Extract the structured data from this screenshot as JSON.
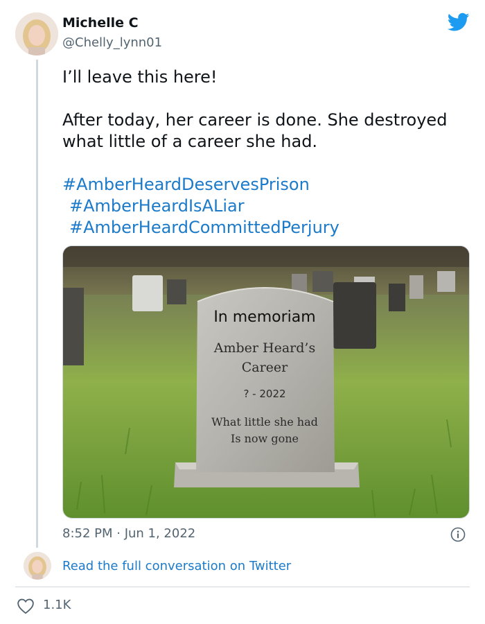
{
  "tweet": {
    "author_name": "Michelle C",
    "author_handle": "@Chelly_lynn01",
    "text_line1": "I’ll leave this here!",
    "text_line2": "After today, her career is done. She destroyed what little of a career she had.",
    "hashtags": [
      "#AmberHeardDeservesPrison",
      "#AmberHeardIsALiar",
      "#AmberHeardCommittedPerjury"
    ],
    "timestamp": "8:52 PM · Jun 1, 2022"
  },
  "image": {
    "tombstone_line1": "In memoriam",
    "tombstone_line2": "Amber Heard’s",
    "tombstone_line3": "Career",
    "tombstone_line4": "? - 2022",
    "tombstone_line5": "What little she had",
    "tombstone_line6": "Is now gone"
  },
  "footer": {
    "read_conversation": "Read the full conversation on Twitter",
    "likes": "1.1K"
  },
  "icons": {
    "twitter": "twitter-bird-icon",
    "info": "info-icon",
    "like": "heart-icon"
  },
  "colors": {
    "accent_blue": "#1b7ac9",
    "twitter_blue": "#1d9bf0",
    "muted_text": "#536471"
  }
}
